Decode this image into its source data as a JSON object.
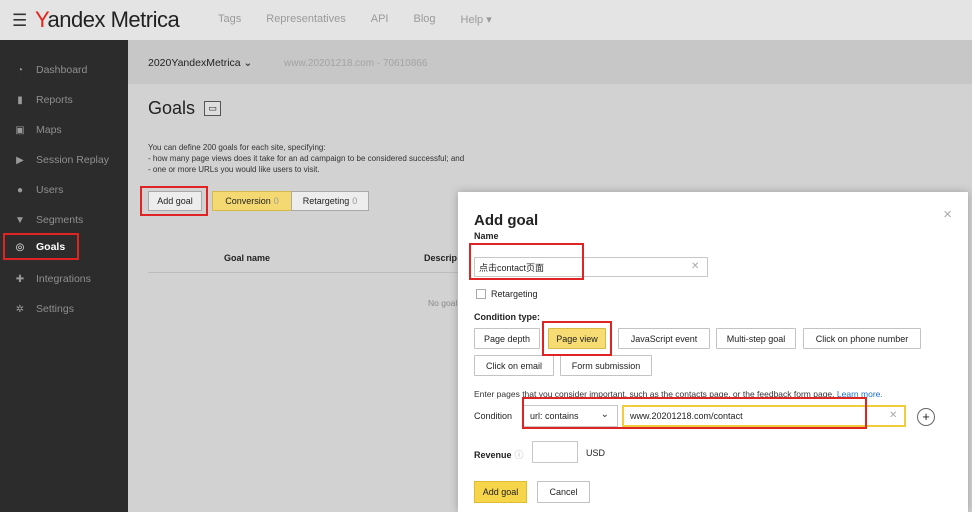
{
  "header": {
    "logo_prefix": "Y",
    "logo_rest": "andex Metrica",
    "nav": [
      "Tags",
      "Representatives",
      "API",
      "Blog",
      "Help ▾"
    ]
  },
  "sidebar": {
    "items": [
      {
        "label": "Dashboard",
        "icon": "dashboard-icon"
      },
      {
        "label": "Reports",
        "icon": "reports-icon"
      },
      {
        "label": "Maps",
        "icon": "maps-icon"
      },
      {
        "label": "Session Replay",
        "icon": "play-icon"
      },
      {
        "label": "Users",
        "icon": "user-icon"
      },
      {
        "label": "Segments",
        "icon": "filter-icon"
      },
      {
        "label": "Goals",
        "icon": "goals-icon"
      },
      {
        "label": "Integrations",
        "icon": "plug-icon"
      },
      {
        "label": "Settings",
        "icon": "gear-icon"
      }
    ]
  },
  "site": {
    "name": "2020YandexMetrica ⌄",
    "url": "www.20201218.com - 70610866"
  },
  "goals_page": {
    "title": "Goals",
    "desc_line1": "You can define 200 goals for each site, specifying:",
    "desc_line2": "- how many page views does it take for an ad campaign to be considered successful; and",
    "desc_line3": "- one or more URLs you would like users to visit.",
    "add_goal": "Add goal",
    "tab_conversion": "Conversion",
    "tab_conversion_count": "0",
    "tab_retargeting": "Retargeting",
    "tab_retargeting_count": "0",
    "col_goal_name": "Goal name",
    "col_description": "Descrip",
    "no_goals": "No goal"
  },
  "modal": {
    "title": "Add goal",
    "close": "×",
    "name_label": "Name",
    "name_value": "点击contact页面",
    "retargeting_label": "Retargeting",
    "condition_type_label": "Condition type:",
    "condition_types": [
      "Page depth",
      "Page view",
      "JavaScript event",
      "Multi-step goal",
      "Click on phone number",
      "Click on email",
      "Form submission"
    ],
    "hint": "Enter pages that you consider important, such as the contacts page, or the feedback form page.",
    "learn_more": "Learn more.",
    "condition_label": "Condition",
    "condition_operator": "url: contains",
    "condition_value": "www.20201218.com/contact",
    "revenue_label": "Revenue",
    "currency": "USD",
    "submit": "Add goal",
    "cancel": "Cancel"
  },
  "colors": {
    "accent_yellow": "#f7d54a",
    "highlight_red": "#e02424",
    "sidebar_bg": "#2c2c2c"
  }
}
